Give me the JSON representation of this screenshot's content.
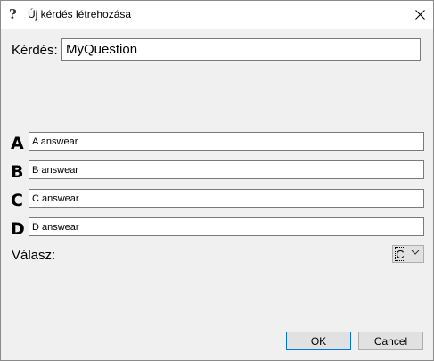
{
  "window": {
    "title": "Új kérdés létrehozása",
    "title_icon": "question-mark-icon",
    "close_icon": "close-icon"
  },
  "question": {
    "label": "Kérdés:",
    "value": "MyQuestion"
  },
  "answers": [
    {
      "letter": "A",
      "value": "A answear"
    },
    {
      "letter": "B",
      "value": "B answear"
    },
    {
      "letter": "C",
      "value": "C answear"
    },
    {
      "letter": "D",
      "value": "D answear"
    }
  ],
  "answer_select": {
    "label": "Válasz:",
    "selected": "C"
  },
  "buttons": {
    "ok": "OK",
    "cancel": "Cancel"
  }
}
